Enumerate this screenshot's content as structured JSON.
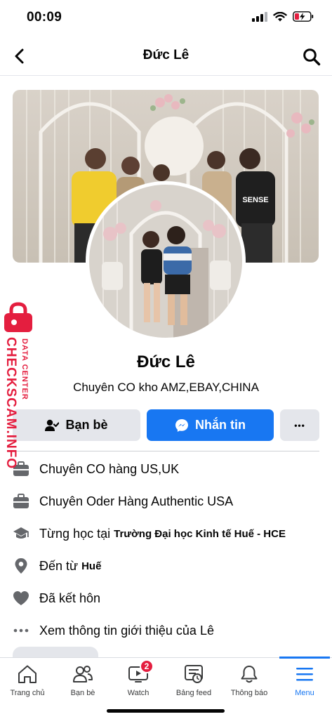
{
  "status_bar": {
    "time": "00:09"
  },
  "nav": {
    "title": "Đức Lê"
  },
  "profile": {
    "name": "Đức Lê",
    "bio": "Chuyên CO kho AMZ,EBAY,CHINA"
  },
  "actions": {
    "friends_label": "Bạn bè",
    "message_label": "Nhắn tin",
    "more_label": "•••"
  },
  "info": [
    {
      "icon": "briefcase-icon",
      "text": "Chuyên CO hàng US,UK"
    },
    {
      "icon": "briefcase-icon",
      "text": "Chuyên Oder Hàng Authentic USA"
    },
    {
      "icon": "graduation-cap-icon",
      "text": "Từng học tại",
      "strong": "Trường Đại học Kinh tế Huế - HCE"
    },
    {
      "icon": "location-pin-icon",
      "text": "Đến từ",
      "strong": "Huế"
    },
    {
      "icon": "heart-icon",
      "text": "Đã kết hôn"
    },
    {
      "icon": "more-dots-icon",
      "text": "Xem thông tin giới thiệu của Lê"
    }
  ],
  "tabs": [
    {
      "label": "Trang chủ",
      "icon": "home-icon"
    },
    {
      "label": "Bạn bè",
      "icon": "friends-icon"
    },
    {
      "label": "Watch",
      "icon": "watch-video-icon",
      "badge": "2"
    },
    {
      "label": "Bảng feed",
      "icon": "feeds-icon"
    },
    {
      "label": "Thông báo",
      "icon": "bell-icon"
    },
    {
      "label": "Menu",
      "icon": "menu-icon",
      "active": true
    }
  ],
  "watermark": {
    "top": "DATA CENTER",
    "main": "CHECKSCAM.INFO"
  },
  "colors": {
    "accent": "#1877f2",
    "button_gray": "#e4e6eb",
    "badge_red": "#e41e3f",
    "watermark_red": "#e41e3f"
  }
}
